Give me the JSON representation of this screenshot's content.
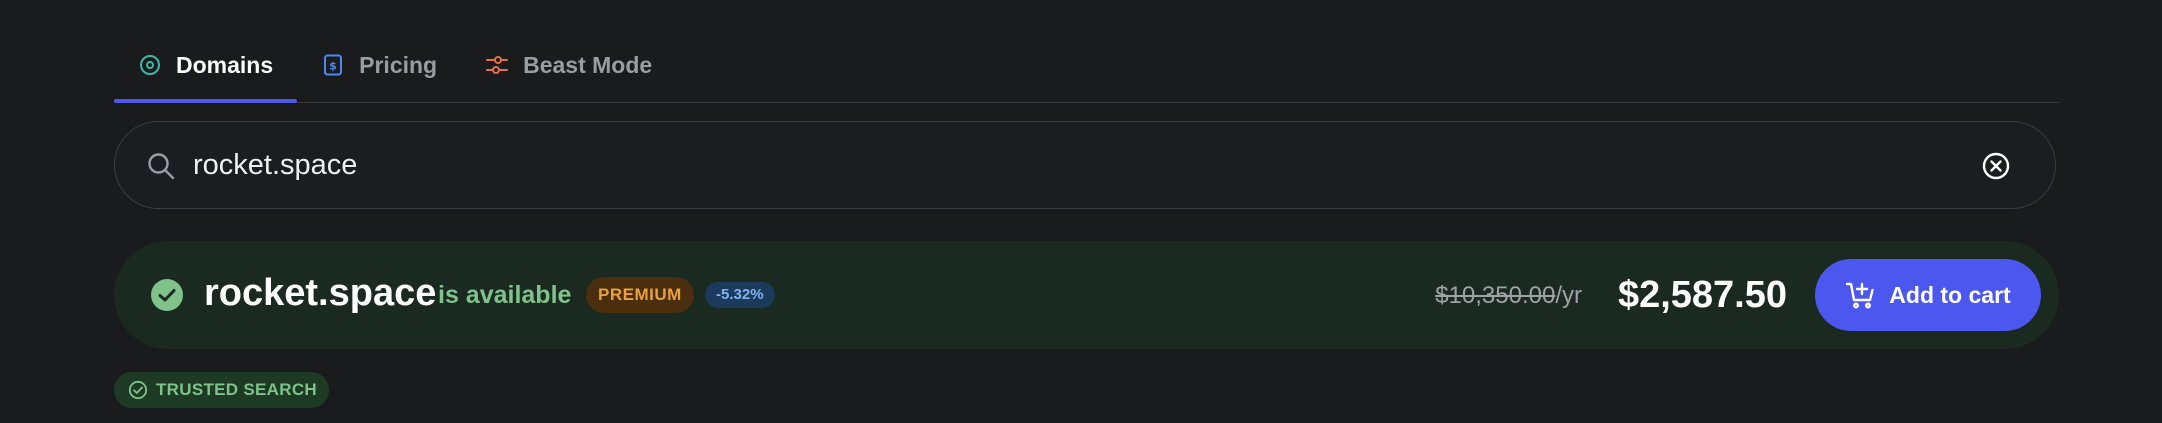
{
  "tabs": [
    {
      "label": "Domains",
      "icon": "target-icon",
      "active": true,
      "icon_color": "#3bb8a8"
    },
    {
      "label": "Pricing",
      "icon": "price-tag-icon",
      "active": false,
      "icon_color": "#4b8bf0"
    },
    {
      "label": "Beast Mode",
      "icon": "sliders-icon",
      "active": false,
      "icon_color": "#e8704a"
    }
  ],
  "search": {
    "value": "rocket.space",
    "icon": "search-icon",
    "clear_icon": "clear-icon"
  },
  "result": {
    "domain": "rocket.space",
    "status_text": "is available",
    "premium_badge": "PREMIUM",
    "discount_badge": "-5.32%",
    "original_price": "$10,350.00",
    "price_period": "/yr",
    "price": "$2,587.50",
    "cart_button_label": "Add to cart",
    "icon": "check-circle-icon"
  },
  "trusted_badge": {
    "label": "TRUSTED SEARCH",
    "icon": "check-circle-outline-icon"
  },
  "colors": {
    "accent": "#4c57f0",
    "available_green": "#7fc28a",
    "premium_orange": "#e9a13b",
    "discount_blue": "#7fb2f0",
    "background": "#1a1b1d"
  }
}
